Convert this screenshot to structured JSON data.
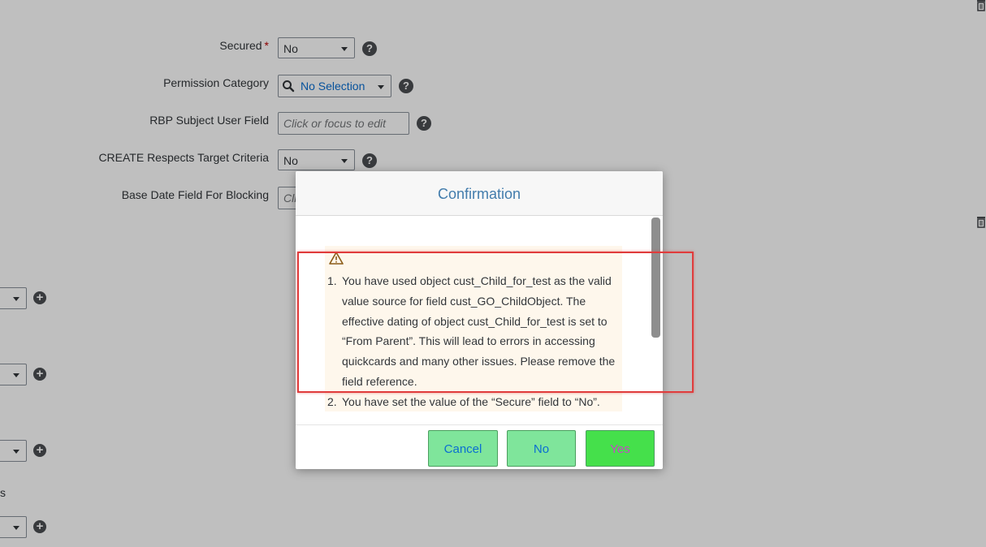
{
  "form": {
    "secured": {
      "label": "Secured",
      "required_mark": "*",
      "value": "No"
    },
    "permission_category": {
      "label": "Permission Category",
      "value": "No Selection"
    },
    "rbp_subject_user_field": {
      "label": "RBP Subject User Field",
      "placeholder": "Click or focus to edit"
    },
    "create_respects_target_criteria": {
      "label": "CREATE Respects Target Criteria",
      "value": "No"
    },
    "base_date_field_for_blocking": {
      "label": "Base Date Field For Blocking",
      "placeholder": "Cli"
    },
    "help_glyph": "?",
    "plus_glyph": "+",
    "stray_text": "s"
  },
  "dialog": {
    "title": "Confirmation",
    "messages": [
      {
        "number": "1.",
        "text": "You have used object cust_Child_for_test as the valid value source for field cust_GO_ChildObject. The effective dating of object cust_Child_for_test is set to “From Parent”. This will lead to errors in accessing quickcards and many other issues. Please remove the field reference."
      },
      {
        "number": "2.",
        "text": "You have set the value of the “Secure” field to “No”."
      }
    ],
    "buttons": {
      "cancel": "Cancel",
      "no": "No",
      "yes": "Yes"
    }
  },
  "colors": {
    "title": "#427cac",
    "warning_bg": "#fef7ec",
    "button_green": "#7fe59b",
    "yes_green": "#45e04b",
    "annotation_red": "#e03c3c"
  },
  "icons": [
    "help-icon",
    "plus-icon",
    "trash-icon",
    "search-icon",
    "warning-icon",
    "chevron-down-icon"
  ]
}
